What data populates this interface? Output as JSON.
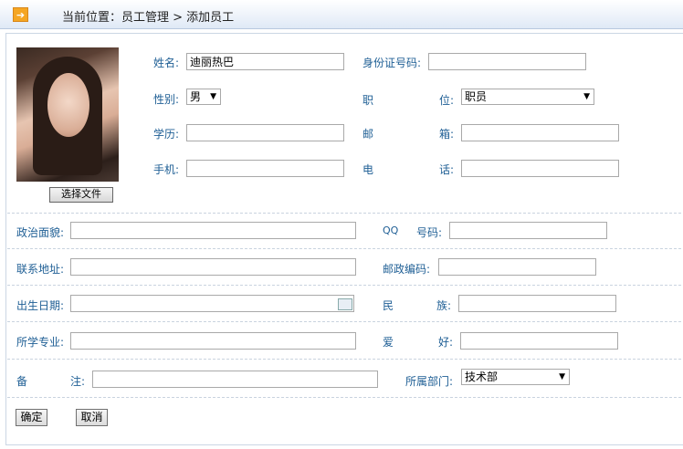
{
  "breadcrumb": {
    "text": "当前位置：员工管理 > 添加员工"
  },
  "photo": {
    "choose_label": "选择文件"
  },
  "fields": {
    "name_label": "姓名:",
    "name_value": "迪丽热巴",
    "idcard_label": "身份证号码:",
    "idcard_value": "",
    "gender_label": "性别:",
    "gender_value": "男",
    "position_label_a": "职",
    "position_label_b": "位:",
    "position_value": "职员",
    "education_label": "学历:",
    "education_value": "",
    "email_label_a": "邮",
    "email_label_b": "箱:",
    "email_value": "",
    "mobile_label": "手机:",
    "mobile_value": "",
    "phone_label_a": "电",
    "phone_label_b": "话:",
    "phone_value": "",
    "political_label": "政治面貌:",
    "political_value": "",
    "qq_label_a": "QQ",
    "qq_label_b": "号码:",
    "qq_value": "",
    "address_label": "联系地址:",
    "address_value": "",
    "postcode_label": "邮政编码:",
    "postcode_value": "",
    "birthday_label": "出生日期:",
    "birthday_value": "",
    "ethnic_label_a": "民",
    "ethnic_label_b": "族:",
    "ethnic_value": "",
    "major_label": "所学专业:",
    "major_value": "",
    "hobby_label_a": "爱",
    "hobby_label_b": "好:",
    "hobby_value": "",
    "note_label_a": "备",
    "note_label_b": "注:",
    "note_value": "",
    "dept_label": "所属部门:",
    "dept_value": "技术部"
  },
  "actions": {
    "confirm_label": "确定",
    "cancel_label": "取消"
  },
  "icons": {
    "breadcrumb_icon": "arrow-right-icon",
    "calendar_icon": "calendar-icon"
  }
}
